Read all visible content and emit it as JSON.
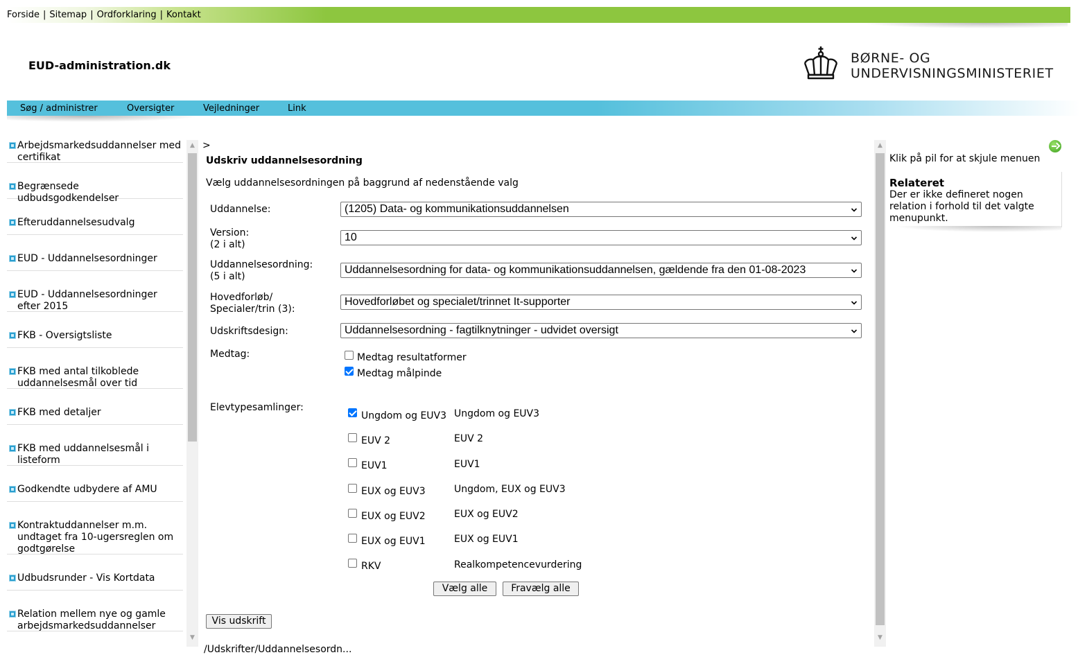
{
  "top_links": [
    "Forside",
    "Sitemap",
    "Ordforklaring",
    "Kontakt"
  ],
  "site_title": "EUD-administration.dk",
  "ministry": {
    "line1": "BØRNE- OG",
    "line2": "UNDERVISNINGSMINISTERIET"
  },
  "nav": [
    "Søg / administrer",
    "Oversigter",
    "Vejledninger",
    "Link"
  ],
  "left_menu": [
    "Arbejdsmarkedsuddannelser med certifikat",
    "Begrænsede udbudsgodkendelser",
    "Efteruddannelsesudvalg",
    "EUD - Uddannelsesordninger",
    "EUD - Uddannelsesordninger efter 2015",
    "FKB - Oversigtsliste",
    "FKB med antal tilkoblede uddannelsesmål over tid",
    "FKB med detaljer",
    "FKB med uddannelsesmål i listeform",
    "Godkendte udbydere af AMU",
    "Kontraktuddannelser m.m. undtaget fra 10-ugersreglen om godtgørelse",
    "Udbudsrunder - Vis Kortdata",
    "Relation mellem nye og gamle arbejdsmarkedsuddannelser"
  ],
  "main": {
    "breadcrumb": ">",
    "title": "Udskriv uddannelsesordning",
    "intro": "Vælg uddannelsesordningen på baggrund af nedenstående valg",
    "fields": {
      "uddannelse": {
        "label": "Uddannelse:",
        "value": "(1205) Data- og kommunikationsuddannelsen"
      },
      "version": {
        "label": "Version:",
        "sub": "(2 i alt)",
        "value": "10"
      },
      "ordning": {
        "label": "Uddannelsesordning:",
        "sub": "(5 i alt)",
        "value": "Uddannelsesordning for data- og kommunikationsuddannelsen, gældende fra den 01-08-2023"
      },
      "hovedforloeb": {
        "label": "Hovedforløb/",
        "sub": "Specialer/trin (3):",
        "value": "Hovedforløbet og specialet/trinnet It-supporter"
      },
      "design": {
        "label": "Udskriftsdesign:",
        "value": "Uddannelsesordning - fagtilknytninger - udvidet oversigt"
      }
    },
    "medtag": {
      "label": "Medtag:",
      "options": [
        {
          "label": "Medtag resultatformer",
          "checked": false
        },
        {
          "label": "Medtag målpinde",
          "checked": true
        }
      ]
    },
    "elevtyper": {
      "label": "Elevtypesamlinger:",
      "rows": [
        {
          "label": "Ungdom og EUV3",
          "desc": "Ungdom og EUV3",
          "checked": true
        },
        {
          "label": "EUV 2",
          "desc": "EUV 2",
          "checked": false
        },
        {
          "label": "EUV1",
          "desc": "EUV1",
          "checked": false
        },
        {
          "label": "EUX og EUV3",
          "desc": "Ungdom, EUX og EUV3",
          "checked": false
        },
        {
          "label": "EUX og EUV2",
          "desc": "EUX og EUV2",
          "checked": false
        },
        {
          "label": "EUX og EUV1",
          "desc": "EUX og EUV1",
          "checked": false
        },
        {
          "label": "RKV",
          "desc": "Realkompetencevurdering",
          "checked": false
        }
      ]
    },
    "buttons": {
      "select_all": "Vælg alle",
      "deselect_all": "Fravælg alle",
      "show_print": "Vis udskrift"
    },
    "cut_text": "/Udskrifter/Uddannelsesordn..."
  },
  "right": {
    "hide_text": "Klik på pil for at skjule menuen",
    "related_title": "Relateret",
    "related_text": "Der er ikke defineret nogen relation i forhold til det valgte menupunkt."
  },
  "colors": {
    "green_bar": "#8dc63f",
    "blue_bar": "#55c0dc",
    "checkbox_checked": "#0075ff"
  }
}
